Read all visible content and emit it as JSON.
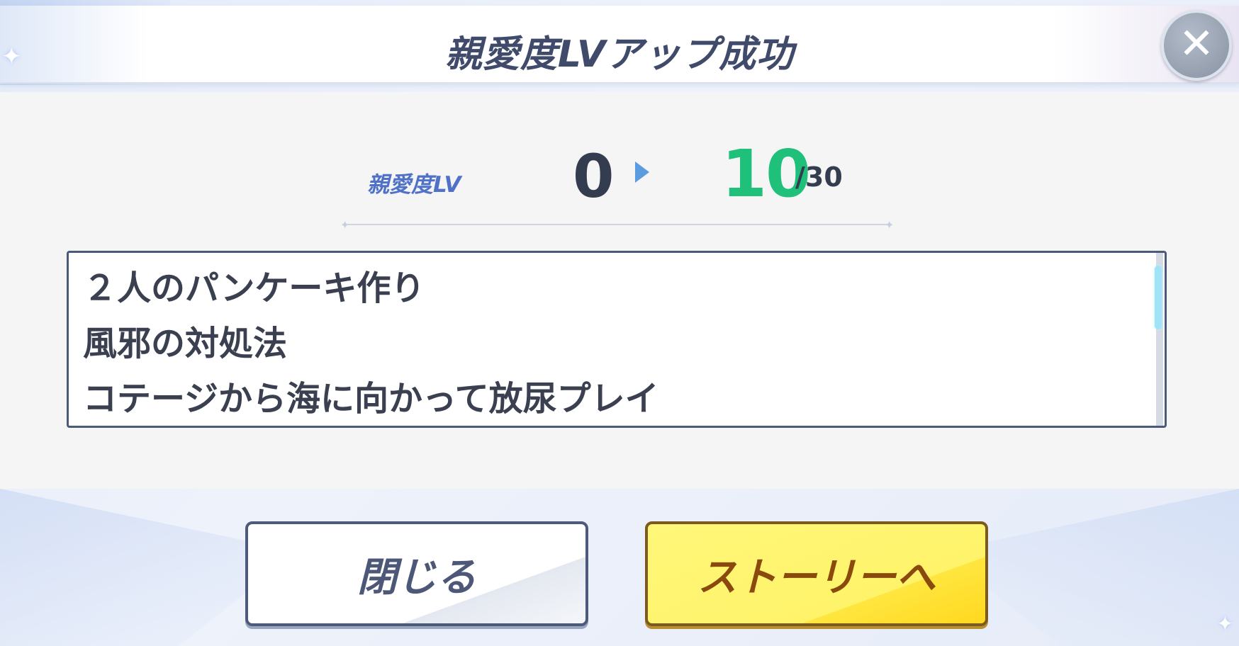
{
  "header": {
    "title": "親愛度LVアップ成功",
    "close_icon": "close-icon"
  },
  "affection": {
    "label": "親愛度LV",
    "from": "0",
    "to": "10",
    "max": "/30",
    "colors": {
      "label": "#4f72c8",
      "to": "#1fc07a"
    }
  },
  "story_list": {
    "items": [
      "２人のパンケーキ作り",
      "風邪の対処法",
      "コテージから海に向かって放尿プレイ"
    ]
  },
  "buttons": {
    "close_label": "閉じる",
    "story_label": "ストーリーへ"
  }
}
